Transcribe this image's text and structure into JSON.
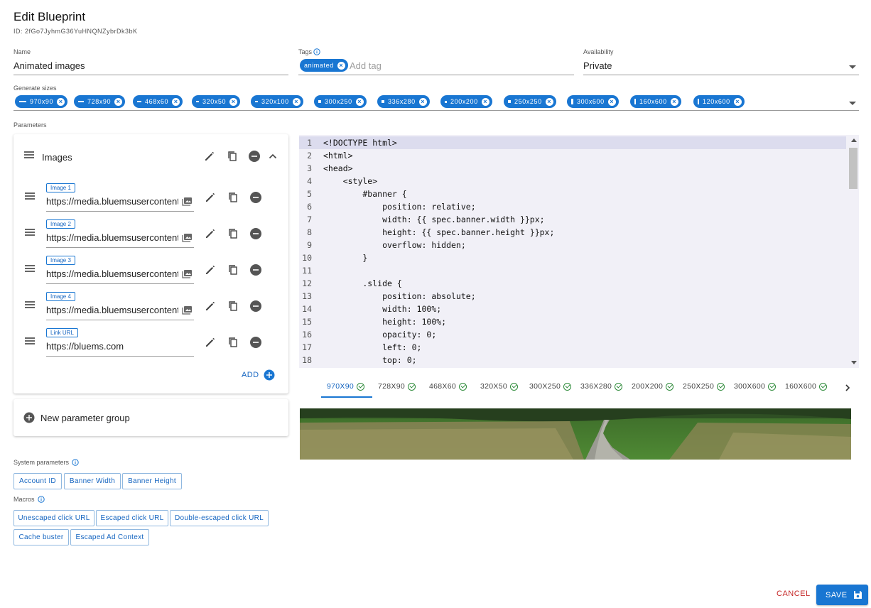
{
  "header": {
    "title": "Edit Blueprint",
    "id_text": "ID: 2fGo7JyhmG36YuHNQNZybrDk3bK"
  },
  "fields": {
    "name_label": "Name",
    "name_value": "Animated images",
    "tags_label": "Tags",
    "tag_chip": "animated",
    "tag_placeholder": "Add tag",
    "availability_label": "Availability",
    "availability_value": "Private",
    "sizes_label": "Generate sizes"
  },
  "sizes": [
    "970x90",
    "728x90",
    "468x60",
    "320x50",
    "320x100",
    "300x250",
    "336x280",
    "200x200",
    "250x250",
    "300x600",
    "160x600",
    "120x600"
  ],
  "parameters": {
    "section_label": "Parameters",
    "group_title": "Images",
    "items": [
      {
        "label": "Image 1",
        "value": "https://media.bluemsusercontent.com"
      },
      {
        "label": "Image 2",
        "value": "https://media.bluemsusercontent.com"
      },
      {
        "label": "Image 3",
        "value": "https://media.bluemsusercontent.com"
      },
      {
        "label": "Image 4",
        "value": "https://media.bluemsusercontent.com"
      },
      {
        "label": "Link URL",
        "value": "https://bluems.com"
      }
    ],
    "add_label": "ADD",
    "new_group_label": "New parameter group"
  },
  "system": {
    "label": "System parameters",
    "buttons": [
      "Account ID",
      "Banner Width",
      "Banner Height"
    ]
  },
  "macros": {
    "label": "Macros",
    "buttons": [
      "Unescaped click URL",
      "Escaped click URL",
      "Double-escaped click URL",
      "Cache buster",
      "Escaped Ad Context"
    ]
  },
  "editor": {
    "lines": [
      "<!DOCTYPE html>",
      "<html>",
      "<head>",
      "    <style>",
      "        #banner {",
      "            position: relative;",
      "            width: {{ spec.banner.width }}px;",
      "            height: {{ spec.banner.height }}px;",
      "            overflow: hidden;",
      "        }",
      "",
      "        .slide {",
      "            position: absolute;",
      "            width: 100%;",
      "            height: 100%;",
      "            opacity: 0;",
      "            left: 0;",
      "            top: 0;"
    ]
  },
  "preview_tabs": [
    "970X90",
    "728X90",
    "468X60",
    "320X50",
    "300X250",
    "336X280",
    "200X200",
    "250X250",
    "300X600",
    "160X600"
  ],
  "footer": {
    "cancel": "CANCEL",
    "save": "SAVE"
  },
  "colors": {
    "primary": "#1976d2",
    "cancel": "#c62828",
    "success": "#2e8b3a",
    "editor_bg": "#f1f0f7"
  }
}
